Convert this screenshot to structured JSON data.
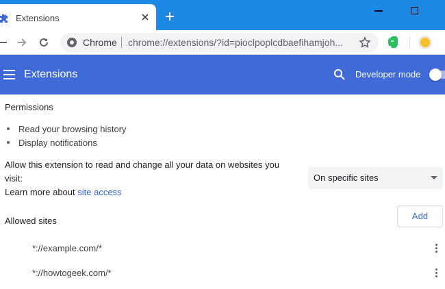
{
  "browser": {
    "tab": {
      "title": "Extensions"
    },
    "omnibox": {
      "site_label": "Chrome",
      "url": "chrome://extensions/?id=pioclpoplcdbaefihamjoh..."
    }
  },
  "header": {
    "title": "Extensions",
    "developer_mode_label": "Developer mode",
    "developer_mode_on": false,
    "color": "#3f6ad8"
  },
  "content": {
    "permissions_heading": "Permissions",
    "permissions": [
      "Read your browsing history",
      "Display notifications"
    ],
    "site_access": {
      "description_line1": "Allow this extension to read and change all your data on websites you",
      "description_line2": "visit:",
      "learn_more_prefix": "Learn more about",
      "learn_more_link": "site access",
      "selected_option": "On specific sites"
    },
    "allowed_sites": {
      "heading": "Allowed sites",
      "add_label": "Add",
      "sites": [
        "*://example.com/*",
        "*://howtogeek.com/*"
      ]
    }
  },
  "icons": {
    "tab": "puzzle-icon",
    "close": "close-icon",
    "new_tab": "plus-icon",
    "star": "star-icon",
    "menu": "hamburger-icon",
    "search": "search-icon",
    "more": "more-vert-icon"
  },
  "colors": {
    "tabstrip": "#1e88e5",
    "link": "#3367d6"
  }
}
